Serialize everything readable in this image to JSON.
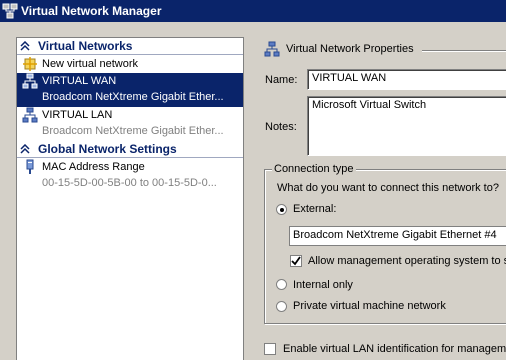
{
  "window": {
    "title": "Virtual Network Manager"
  },
  "sidebar": {
    "sections": [
      {
        "label": "Virtual Networks"
      },
      {
        "label": "Global Network Settings"
      }
    ],
    "items": [
      {
        "label": "New virtual network"
      },
      {
        "label": "VIRTUAL WAN",
        "sub": "Broadcom NetXtreme Gigabit Ether..."
      },
      {
        "label": "VIRTUAL LAN",
        "sub": "Broadcom NetXtreme Gigabit Ether..."
      },
      {
        "label": "MAC Address Range",
        "sub": "00-15-5D-00-5B-00 to 00-15-5D-0..."
      }
    ]
  },
  "properties": {
    "header": "Virtual Network Properties",
    "name_label": "Name:",
    "name_value": "VIRTUAL WAN",
    "notes_label": "Notes:",
    "notes_value": "Microsoft Virtual Switch",
    "connection": {
      "title": "Connection type",
      "question": "What do you want to connect this network to?",
      "external_label": "External:",
      "adapter": "Broadcom NetXtreme Gigabit Ethernet #4",
      "allow_mgmt_label": "Allow management operating system to s",
      "internal_label": "Internal only",
      "private_label": "Private virtual machine network"
    },
    "vlan_label": "Enable virtual LAN identification for manageme"
  }
}
